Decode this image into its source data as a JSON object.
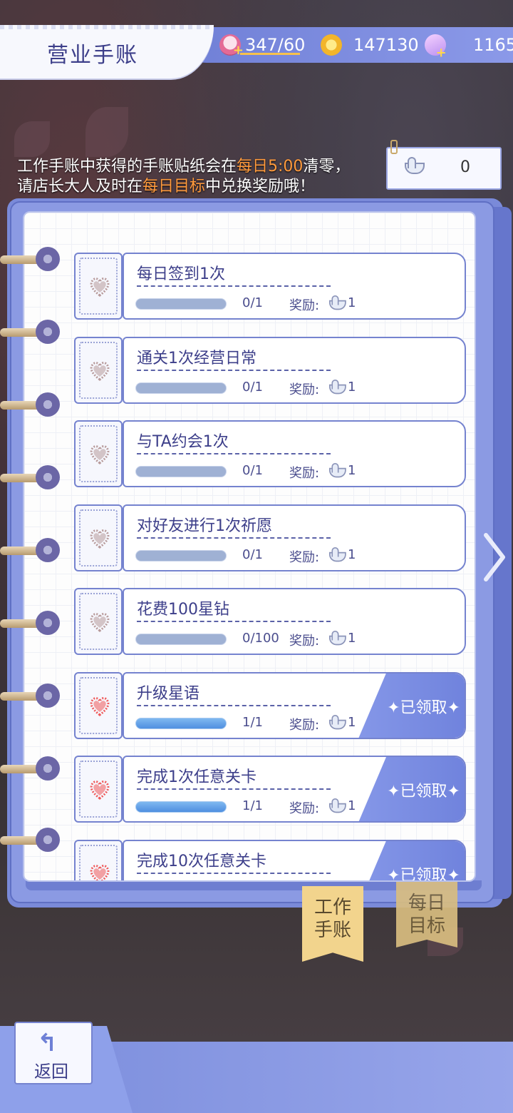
{
  "header": {
    "title": "营业手账",
    "stamina": "347/60",
    "coins": "147130",
    "gems": "1165"
  },
  "notice": {
    "line1_a": "工作手账中获得的手账贴纸会在",
    "line1_hl": "每日5:00",
    "line1_b": "清零，",
    "line2_a": "请店长大人及时在",
    "line2_hl": "每日目标",
    "line2_b": "中兑换奖励哦！"
  },
  "sticker_count": "0",
  "reward_label": "奖励:",
  "claimed_label": "✦已领取✦",
  "tasks": [
    {
      "name": "每日签到1次",
      "progress": "0/1",
      "reward": "1",
      "done": false
    },
    {
      "name": "通关1次经营日常",
      "progress": "0/1",
      "reward": "1",
      "done": false
    },
    {
      "name": "与TA约会1次",
      "progress": "0/1",
      "reward": "1",
      "done": false
    },
    {
      "name": "对好友进行1次祈愿",
      "progress": "0/1",
      "reward": "1",
      "done": false
    },
    {
      "name": "花费100星钻",
      "progress": "0/100",
      "reward": "1",
      "done": false
    },
    {
      "name": "升级星语",
      "progress": "1/1",
      "reward": "1",
      "done": true
    },
    {
      "name": "完成1次任意关卡",
      "progress": "1/1",
      "reward": "1",
      "done": true
    },
    {
      "name": "完成10次任意关卡",
      "progress": "",
      "reward": "",
      "done": true
    }
  ],
  "tabs": {
    "work_line1": "工作",
    "work_line2": "手账",
    "daily_line1": "每日",
    "daily_line2": "目标"
  },
  "back_label": "返回",
  "colors": {
    "accent": "#7583cf",
    "highlight": "#ff9a3c",
    "tab": "#f2d48d"
  }
}
